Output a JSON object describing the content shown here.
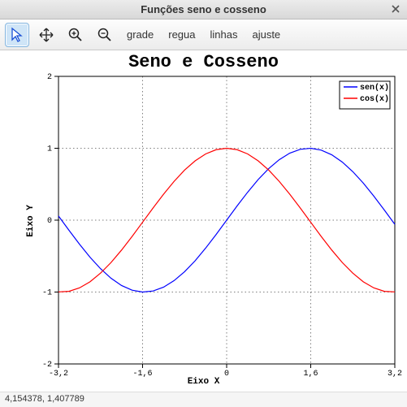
{
  "window": {
    "title": "Funções seno e cosseno"
  },
  "toolbar": {
    "grade": "grade",
    "regua": "regua",
    "linhas": "linhas",
    "ajuste": "ajuste"
  },
  "statusbar": {
    "coords": "4,154378, 1,407789"
  },
  "chart_data": {
    "type": "line",
    "title": "Seno e Cosseno",
    "xlabel": "Eixo X",
    "ylabel": "Eixo Y",
    "xlim": [
      -3.2,
      3.2
    ],
    "ylim": [
      -2,
      2
    ],
    "xticks": [
      -3.2,
      -1.6,
      0,
      1.6,
      3.2
    ],
    "xticklabels": [
      "-3,2",
      "-1,6",
      "0",
      "1,6",
      "3,2"
    ],
    "yticks": [
      -2,
      -1,
      0,
      1,
      2
    ],
    "yticklabels": [
      "-2",
      "-1",
      "0",
      "1",
      "2"
    ],
    "legend": {
      "entries": [
        "sen(x)",
        "cos(x)"
      ],
      "colors": [
        "#0000ff",
        "#ff0000"
      ],
      "position": "upper right"
    },
    "series": [
      {
        "name": "sen(x)",
        "color": "#0000ff",
        "x": [
          -3.2,
          -3.0,
          -2.8,
          -2.6,
          -2.4,
          -2.2,
          -2.0,
          -1.8,
          -1.6,
          -1.4,
          -1.2,
          -1.0,
          -0.8,
          -0.6,
          -0.4,
          -0.2,
          0.0,
          0.2,
          0.4,
          0.6,
          0.8,
          1.0,
          1.2,
          1.4,
          1.6,
          1.8,
          2.0,
          2.2,
          2.4,
          2.6,
          2.8,
          3.0,
          3.2
        ],
        "y": [
          0.058,
          -0.141,
          -0.335,
          -0.516,
          -0.675,
          -0.808,
          -0.909,
          -0.974,
          -1.0,
          -0.985,
          -0.932,
          -0.841,
          -0.717,
          -0.565,
          -0.389,
          -0.199,
          0.0,
          0.199,
          0.389,
          0.565,
          0.717,
          0.841,
          0.932,
          0.985,
          1.0,
          0.974,
          0.909,
          0.808,
          0.675,
          0.516,
          0.335,
          0.141,
          -0.058
        ]
      },
      {
        "name": "cos(x)",
        "color": "#ff0000",
        "x": [
          -3.2,
          -3.0,
          -2.8,
          -2.6,
          -2.4,
          -2.2,
          -2.0,
          -1.8,
          -1.6,
          -1.4,
          -1.2,
          -1.0,
          -0.8,
          -0.6,
          -0.4,
          -0.2,
          0.0,
          0.2,
          0.4,
          0.6,
          0.8,
          1.0,
          1.2,
          1.4,
          1.6,
          1.8,
          2.0,
          2.2,
          2.4,
          2.6,
          2.8,
          3.0,
          3.2
        ],
        "y": [
          -0.998,
          -0.99,
          -0.942,
          -0.857,
          -0.737,
          -0.589,
          -0.416,
          -0.227,
          -0.029,
          0.17,
          0.362,
          0.54,
          0.697,
          0.825,
          0.921,
          0.98,
          1.0,
          0.98,
          0.921,
          0.825,
          0.697,
          0.54,
          0.362,
          0.17,
          -0.029,
          -0.227,
          -0.416,
          -0.589,
          -0.737,
          -0.857,
          -0.942,
          -0.99,
          -0.998
        ]
      }
    ]
  }
}
